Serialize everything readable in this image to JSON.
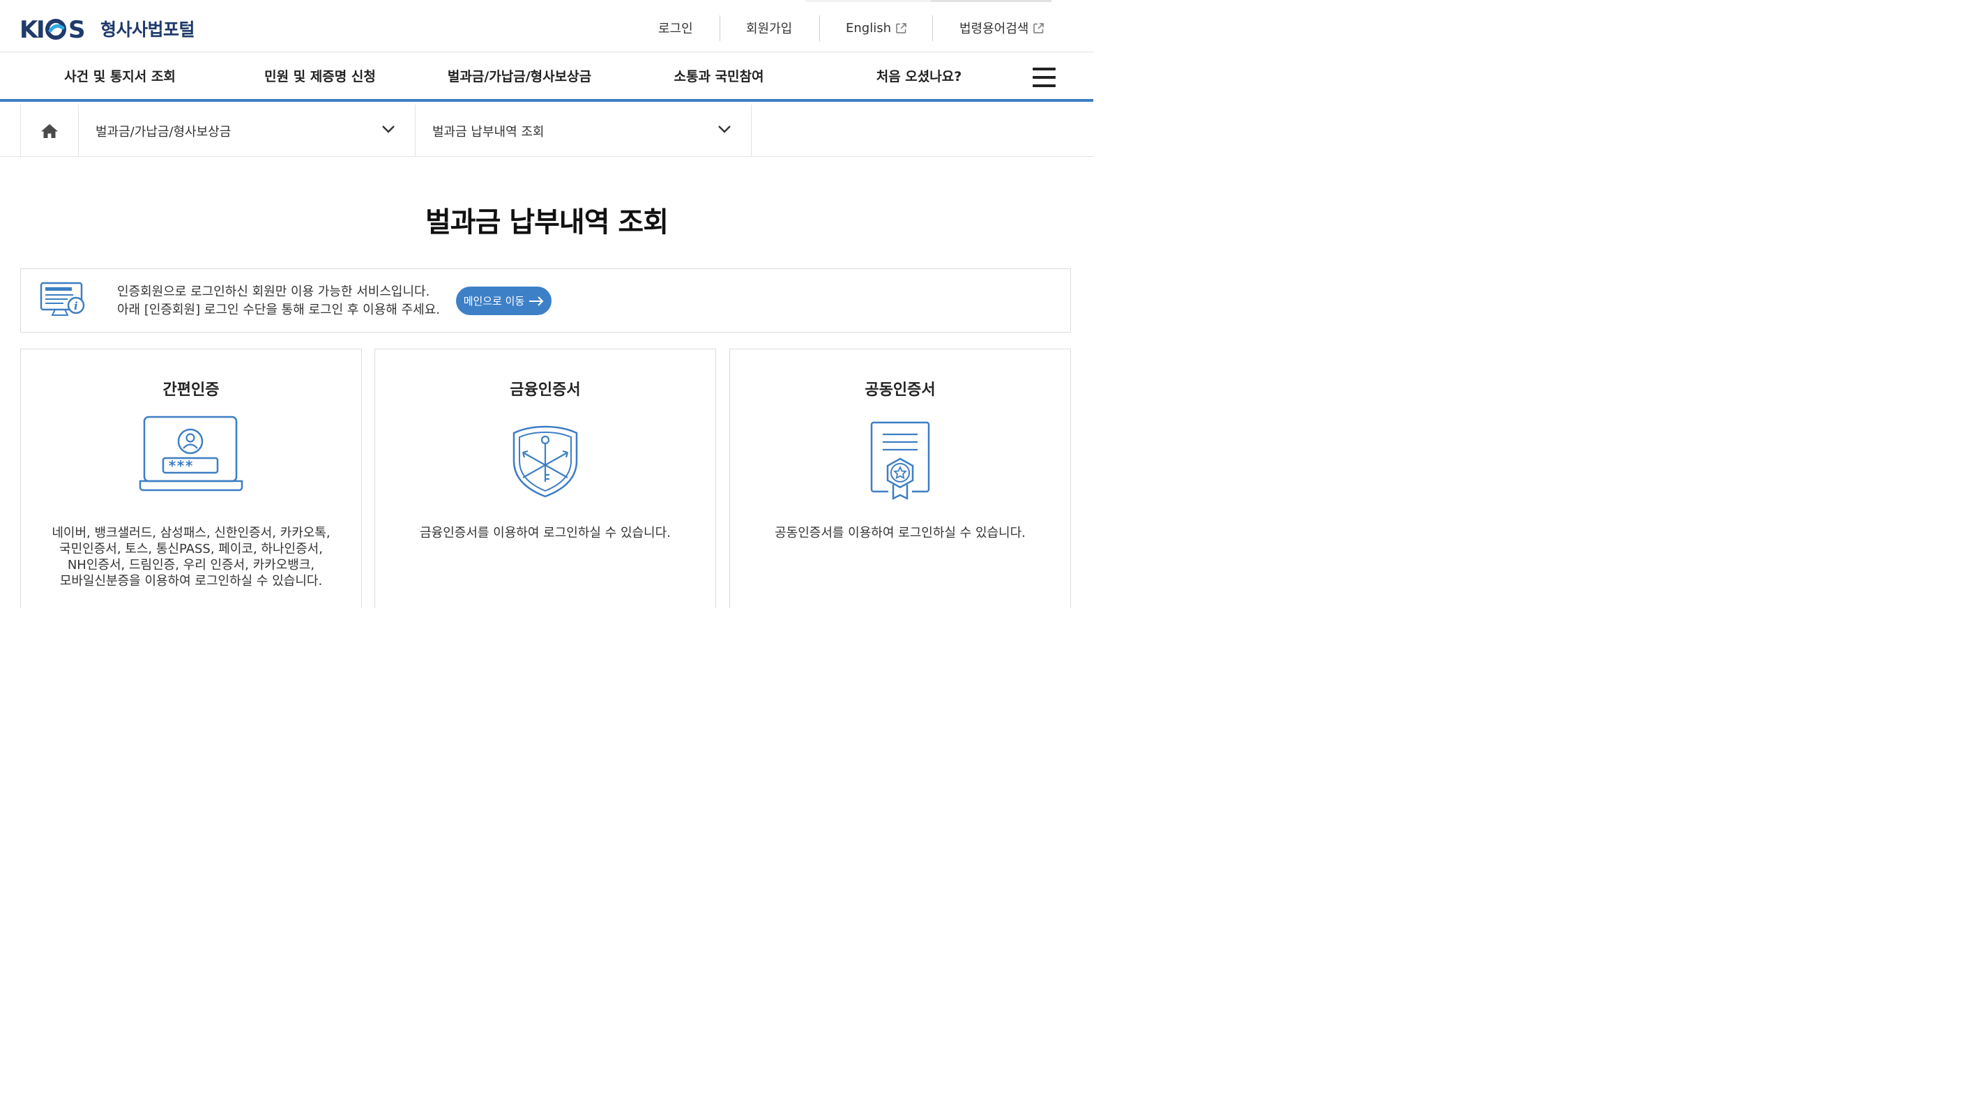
{
  "header": {
    "logo_mark": "KICS",
    "logo_text": "형사사법포털",
    "util_links": {
      "login": "로그인",
      "signup": "회원가입",
      "english": "English",
      "law_search": "법령용어검색"
    },
    "icons": {
      "external": "external-link-icon"
    }
  },
  "gnb": {
    "items": [
      "사건 및 통지서 조회",
      "민원 및 제증명 신청",
      "벌과금/가납금/형사보상금",
      "소통과 국민참여",
      "처음 오셨나요?"
    ],
    "menu_icon": "hamburger-menu-icon"
  },
  "breadcrumb": {
    "home_icon": "home-icon",
    "level1": "벌과금/가납금/형사보상금",
    "level2": "벌과금 납부내역 조회"
  },
  "page": {
    "title": "벌과금 납부내역 조회"
  },
  "notice": {
    "line1": "인증회원으로 로그인하신 회원만 이용 가능한 서비스입니다.",
    "line2": "아래 [인증회원] 로그인 수단을 통해 로그인 후 이용해 주세요.",
    "button": "메인으로 이동",
    "icon": "certificate-info-icon"
  },
  "cards": [
    {
      "title": "간편인증",
      "icon": "laptop-user-password-icon",
      "desc": "네이버, 뱅크샐러드, 삼성패스, 신한인증서, 카카오톡,\n국민인증서, 토스, 통신PASS, 페이코, 하나인증서,\nNH인증서, 드림인증, 우리 인증서, 카카오뱅크,\n모바일신분증을 이용하여 로그인하실 수 있습니다."
    },
    {
      "title": "금융인증서",
      "icon": "shield-key-icon",
      "desc": "금융인증서를 이용하여 로그인하실 수 있습니다."
    },
    {
      "title": "공동인증서",
      "icon": "certificate-badge-icon",
      "desc": "공동인증서를 이용하여 로그인하실 수 있습니다."
    }
  ],
  "colors": {
    "accent": "#3d7ec4",
    "logo": "#1f3a6b",
    "button": "#3d80c8"
  }
}
